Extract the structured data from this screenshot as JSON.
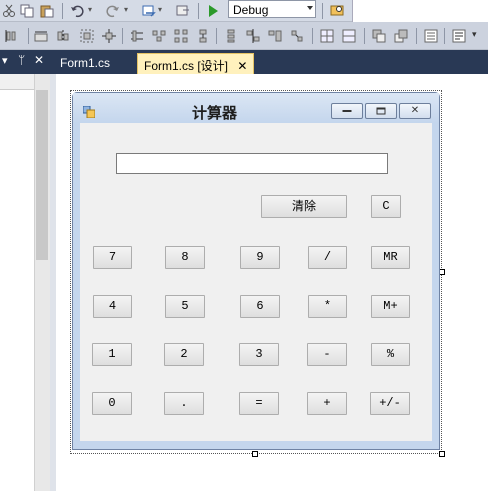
{
  "toolbar": {
    "config_value": "Debug",
    "icons_row1": [
      "cut-icon",
      "copy-icon",
      "paste-icon",
      "undo-icon",
      "redo-icon",
      "navigate-icon",
      "publish-icon",
      "start-icon",
      "find-in-files-icon"
    ],
    "icons_row2": [
      "align-lefts-icon",
      "align-centers-icon",
      "align-rights-icon",
      "align-tops-icon",
      "align-middles-icon",
      "align-bottoms-icon",
      "make-same-width-icon",
      "size-to-grid-icon",
      "horizontal-spacing-icon",
      "vertical-spacing-icon",
      "center-horizontally-icon",
      "center-vertically-icon",
      "bring-to-front-icon",
      "send-to-back-icon",
      "tab-order-icon",
      "overflow-icon"
    ]
  },
  "tabs": [
    {
      "label": "Form1.cs",
      "active": false
    },
    {
      "label": "Form1.cs [设计]",
      "active": true,
      "close": "✕"
    }
  ],
  "left_panel": {
    "pin": "▾ ᛘ ✕"
  },
  "form": {
    "title": "计算器",
    "display_value": "",
    "buttons": {
      "clear": "清除",
      "c": "C",
      "b7": "7",
      "b8": "8",
      "b9": "9",
      "div": "/",
      "mr": "MR",
      "b4": "4",
      "b5": "5",
      "b6": "6",
      "mul": "*",
      "mplus": "M+",
      "b1": "1",
      "b2": "2",
      "b3": "3",
      "sub": "-",
      "pct": "%",
      "b0": "0",
      "dot": ".",
      "eq": "=",
      "add": "+",
      "neg": "+/-"
    }
  }
}
